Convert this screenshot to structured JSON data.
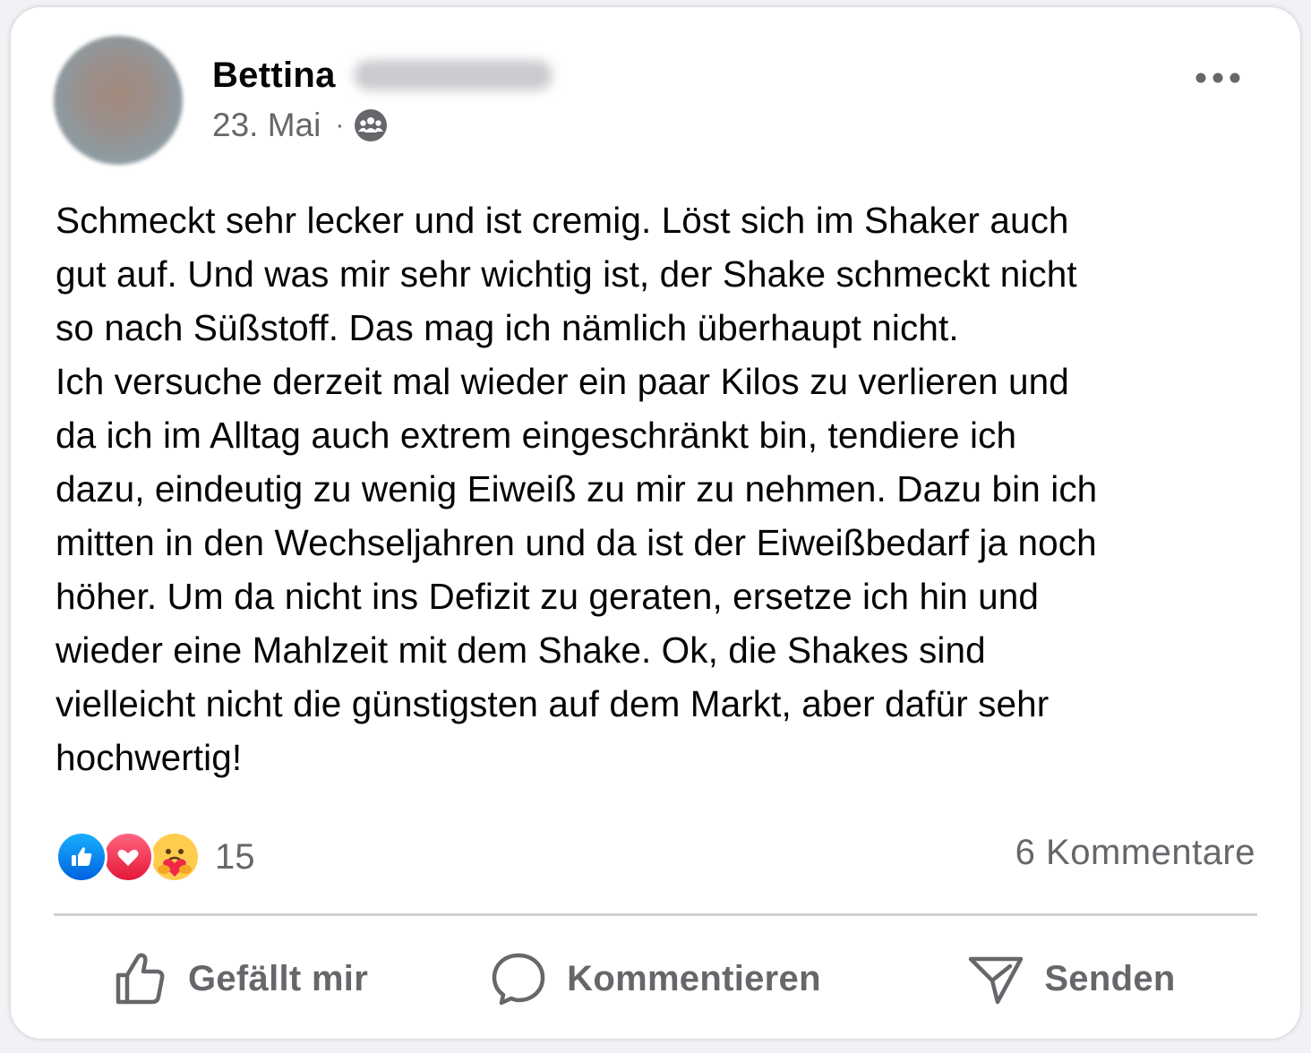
{
  "post": {
    "author_first_name": "Bettina",
    "date": "23. Mai",
    "meta_separator": "·",
    "audience_icon": "group-icon",
    "more_icon": "more-horizontal-icon",
    "text": "Schmeckt sehr lecker und ist cremig. Löst sich im Shaker auch\ngut auf. Und was mir sehr wichtig ist, der Shake schmeckt nicht\nso nach Süßstoff. Das mag ich nämlich überhaupt nicht.\nIch versuche derzeit mal wieder ein paar Kilos zu verlieren und\nda ich im Alltag auch extrem eingeschränkt bin, tendiere ich\ndazu, eindeutig zu wenig Eiweiß zu mir zu nehmen. Dazu bin ich\nmitten in den Wechseljahren und da ist der Eiweißbedarf ja noch\nhöher. Um da nicht ins Defizit zu geraten, ersetze ich hin und\nwieder eine Mahlzeit mit dem Shake. Ok, die Shakes sind\nvielleicht nicht die günstigsten auf dem Markt, aber dafür sehr\nhochwertig!"
  },
  "reactions": {
    "icons": [
      "like-icon",
      "love-icon",
      "care-icon"
    ],
    "count": "15",
    "comments": "6 Kommentare"
  },
  "actions": {
    "like_label": "Gefällt mir",
    "comment_label": "Kommentieren",
    "send_label": "Senden"
  },
  "colors": {
    "text_primary": "#050505",
    "text_secondary": "#65676b",
    "like_blue": "#0866ff",
    "love_red": "#f33e58",
    "divider": "#ced0d4"
  }
}
